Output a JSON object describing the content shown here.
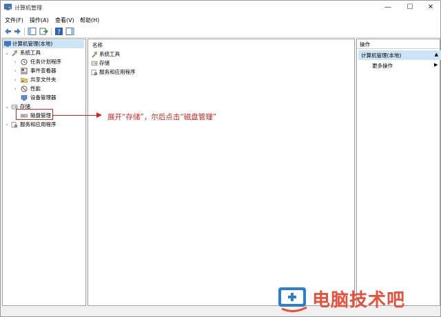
{
  "window": {
    "title": "计算机管理",
    "controls": {
      "minimize": "—",
      "maximize": "☐",
      "close": "✕"
    }
  },
  "menu": [
    "文件(F)",
    "操作(A)",
    "查看(V)",
    "帮助(H)"
  ],
  "tree": {
    "root": "计算机管理(本地)",
    "system_tools": "系统工具",
    "children_system": [
      "任务计划程序",
      "事件查看器",
      "共享文件夹",
      "性能",
      "设备管理器"
    ],
    "storage": "存储",
    "disk_management": "磁盘管理",
    "services": "服务和应用程序"
  },
  "list": {
    "column_header": "名称",
    "items": [
      "系统工具",
      "存储",
      "服务和应用程序"
    ]
  },
  "actions": {
    "header": "操作",
    "selected": "计算机管理(本地)",
    "more": "更多操作"
  },
  "annotation": "展开“存储”，尔后点击“磁盘管理”",
  "watermark": "电脑技术吧",
  "colors": {
    "annotation": "#d9231c",
    "selection": "#cce4f7",
    "watermark": "#e8503a"
  }
}
